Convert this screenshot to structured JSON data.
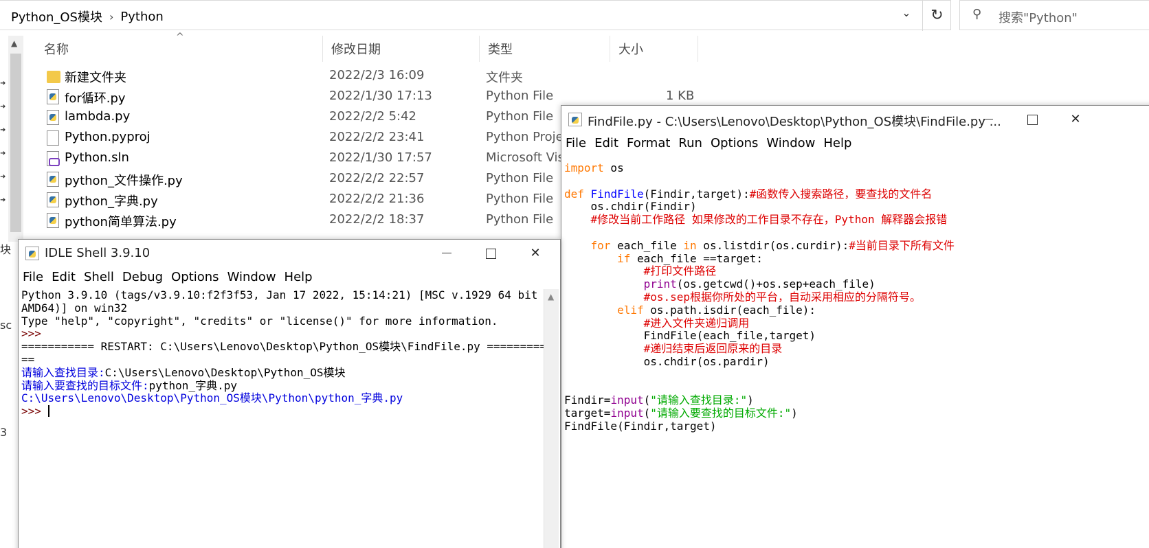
{
  "explorer": {
    "breadcrumb": [
      "Python_OS模块",
      "Python"
    ],
    "breadcrumb_sep": "›",
    "dropdown_icon": "⌄",
    "refresh_icon": "↻",
    "search_icon": "⚲",
    "search_placeholder": "搜索\"Python\"",
    "sort_caret": "^",
    "columns": {
      "name": "名称",
      "date": "修改日期",
      "type": "类型",
      "size": "大小"
    },
    "files": [
      {
        "icon": "folder-icon",
        "name": "新建文件夹",
        "date": "2022/2/3 16:09",
        "type": "文件夹",
        "size": ""
      },
      {
        "icon": "python-file-icon",
        "name": "for循环.py",
        "date": "2022/1/30 17:13",
        "type": "Python File",
        "size": "1 KB"
      },
      {
        "icon": "python-file-icon",
        "name": "lambda.py",
        "date": "2022/2/2 5:42",
        "type": "Python File",
        "size": ""
      },
      {
        "icon": "document-icon",
        "name": "Python.pyproj",
        "date": "2022/2/2 23:41",
        "type": "Python Projec",
        "size": ""
      },
      {
        "icon": "solution-file-icon",
        "name": "Python.sln",
        "date": "2022/1/30 17:57",
        "type": "Microsoft Visu",
        "size": ""
      },
      {
        "icon": "python-file-icon",
        "name": "python_文件操作.py",
        "date": "2022/2/2 22:57",
        "type": "Python File",
        "size": ""
      },
      {
        "icon": "python-file-icon",
        "name": "python_字典.py",
        "date": "2022/2/2 21:36",
        "type": "Python File",
        "size": ""
      },
      {
        "icon": "python-file-icon",
        "name": "python简单算法.py",
        "date": "2022/2/2 18:37",
        "type": "Python File",
        "size": ""
      }
    ],
    "edge_fragments": [
      "块",
      "sc",
      "3"
    ]
  },
  "editor": {
    "title": "FindFile.py - C:\\Users\\Lenovo\\Desktop\\Python_OS模块\\FindFile.py ...",
    "minimize_icon": "—",
    "maximize_icon": "☐",
    "close_icon": "✕",
    "menu": [
      "File",
      "Edit",
      "Format",
      "Run",
      "Options",
      "Window",
      "Help"
    ],
    "code": {
      "l1_kw": "import",
      "l1_rest": " os",
      "l3_kw": "def",
      "l3_fn": "FindFile",
      "l3_rest": "(Findir,target):",
      "l3_cm": "#函数传入搜索路径，要查找的文件名",
      "l4": "    os.chdir(Findir)",
      "l5_cm": "#修改当前工作路径 如果修改的工作目录不存在，Python 解释器会报错",
      "l7_kw1": "for",
      "l7_a": " each_file ",
      "l7_kw2": "in",
      "l7_b": " os.listdir(os.curdir):",
      "l7_cm": "#当前目录下所有文件",
      "l8_kw": "if",
      "l8_rest": " each_file ==target:",
      "l9_cm": "#打印文件路径",
      "l10_bi": "print",
      "l10_rest": "(os.getcwd()+os.sep+each_file)",
      "l11_cm": "#os.sep根据你所处的平台，自动采用相应的分隔符号。",
      "l12_kw": "elif",
      "l12_rest": " os.path.isdir(each_file):",
      "l13_cm": "#进入文件夹递归调用",
      "l14": "FindFile(each_file,target)",
      "l15_cm": "#递归结束后返回原来的目录",
      "l16": "os.chdir(os.pardir)",
      "l19_a": "Findir=",
      "l19_bi": "input",
      "l19_b": "(",
      "l19_st": "\"请输入查找目录:\"",
      "l19_c": ")",
      "l20_a": "target=",
      "l20_bi": "input",
      "l20_b": "(",
      "l20_st": "\"请输入要查找的目标文件:\"",
      "l20_c": ")",
      "l21": "FindFile(Findir,target)"
    }
  },
  "shell": {
    "title": "IDLE Shell 3.9.10",
    "minimize_icon": "—",
    "maximize_icon": "☐",
    "close_icon": "✕",
    "menu": [
      "File",
      "Edit",
      "Shell",
      "Debug",
      "Options",
      "Window",
      "Help"
    ],
    "lines": {
      "banner1": "Python 3.9.10 (tags/v3.9.10:f2f3f53, Jan 17 2022, 15:14:21) [MSC v.1929 64 bit (",
      "banner2": "AMD64)] on win32",
      "banner3": "Type \"help\", \"copyright\", \"credits\" or \"license()\" for more information.",
      "prompt": ">>> ",
      "restart1": "=========== RESTART: C:\\Users\\Lenovo\\Desktop\\Python_OS模块\\FindFile.py =========",
      "restart2": "==",
      "in1_label": "请输入查找目录:",
      "in1_value": "C:\\Users\\Lenovo\\Desktop\\Python_OS模块",
      "in2_label": "请输入要查找的目标文件:",
      "in2_value": "python_字典.py",
      "result": "C:\\Users\\Lenovo\\Desktop\\Python_OS模块\\Python\\python_字典.py"
    }
  }
}
